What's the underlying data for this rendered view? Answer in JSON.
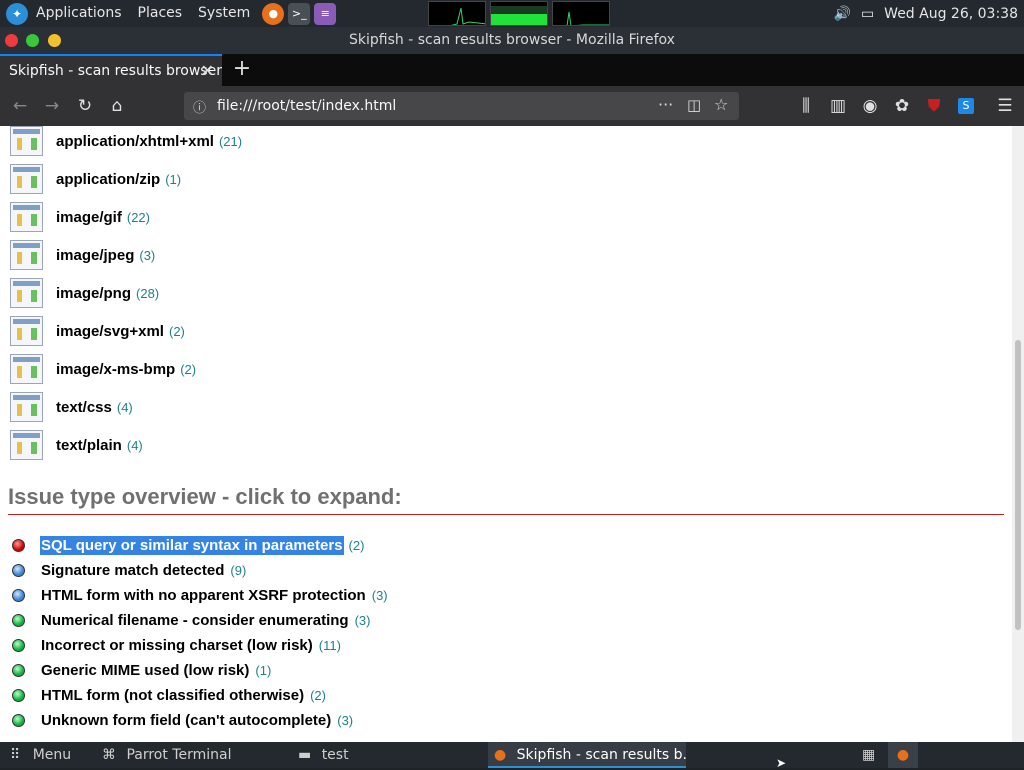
{
  "topbar": {
    "menus": [
      "Applications",
      "Places",
      "System"
    ],
    "clock": "Wed Aug 26, 03:38"
  },
  "window": {
    "title": "Skipfish - scan results browser - Mozilla Firefox"
  },
  "browser": {
    "tab_title": "Skipfish - scan results browser",
    "url": "file:///root/test/index.html"
  },
  "mime_types": [
    {
      "name": "application/xhtml+xml",
      "count": "(21)"
    },
    {
      "name": "application/zip",
      "count": "(1)"
    },
    {
      "name": "image/gif",
      "count": "(22)"
    },
    {
      "name": "image/jpeg",
      "count": "(3)"
    },
    {
      "name": "image/png",
      "count": "(28)"
    },
    {
      "name": "image/svg+xml",
      "count": "(2)"
    },
    {
      "name": "image/x-ms-bmp",
      "count": "(2)"
    },
    {
      "name": "text/css",
      "count": "(4)"
    },
    {
      "name": "text/plain",
      "count": "(4)"
    }
  ],
  "issues_heading": "Issue type overview - click to expand:",
  "issues": [
    {
      "label": "SQL query or similar syntax in parameters",
      "count": "(2)",
      "severity": "red"
    },
    {
      "label": "Signature match detected",
      "count": "(9)",
      "severity": "blue"
    },
    {
      "label": "HTML form with no apparent XSRF protection",
      "count": "(3)",
      "severity": "blue"
    },
    {
      "label": "Numerical filename - consider enumerating",
      "count": "(3)",
      "severity": "green"
    },
    {
      "label": "Incorrect or missing charset (low risk)",
      "count": "(11)",
      "severity": "green"
    },
    {
      "label": "Generic MIME used (low risk)",
      "count": "(1)",
      "severity": "green"
    },
    {
      "label": "HTML form (not classified otherwise)",
      "count": "(2)",
      "severity": "green"
    },
    {
      "label": "Unknown form field (can't autocomplete)",
      "count": "(3)",
      "severity": "green"
    }
  ],
  "taskbar": {
    "menu": "Menu",
    "tasks": [
      "Parrot Terminal",
      "test",
      "Skipfish - scan results b..."
    ]
  }
}
